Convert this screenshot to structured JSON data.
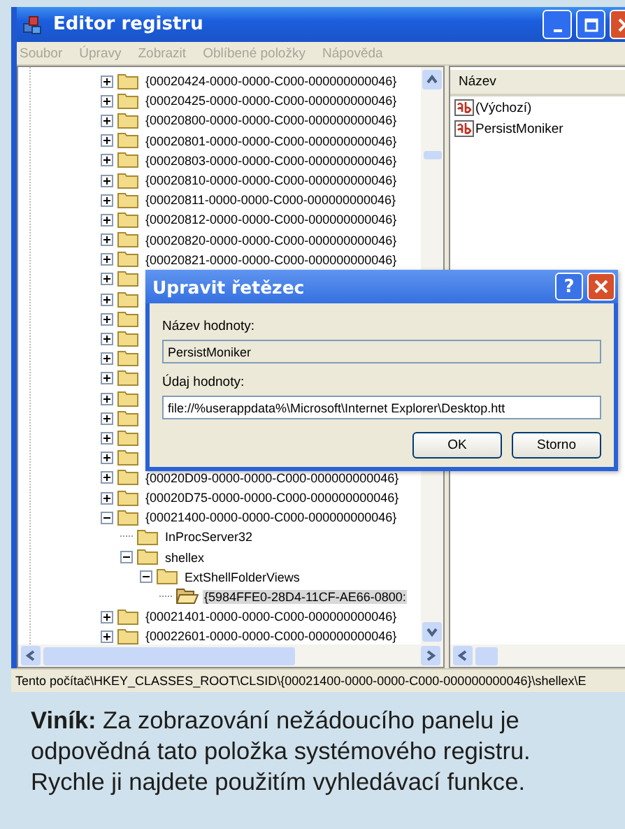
{
  "window": {
    "title": "Editor registru"
  },
  "menu": [
    {
      "label": "Soubor",
      "disabled": true
    },
    {
      "label": "Úpravy",
      "disabled": true
    },
    {
      "label": "Zobrazit",
      "disabled": true
    },
    {
      "label": "Oblíbené položky",
      "disabled": true
    },
    {
      "label": "Nápověda",
      "disabled": true
    }
  ],
  "tree": [
    {
      "label": "{00020424-0000-0000-C000-000000000046}",
      "expanded": false,
      "selected": false
    },
    {
      "label": "{00020425-0000-0000-C000-000000000046}",
      "expanded": false,
      "selected": false
    },
    {
      "label": "{00020800-0000-0000-C000-000000000046}",
      "expanded": false,
      "selected": false
    },
    {
      "label": "{00020801-0000-0000-C000-000000000046}",
      "expanded": false,
      "selected": false
    },
    {
      "label": "{00020803-0000-0000-C000-000000000046}",
      "expanded": false,
      "selected": false
    },
    {
      "label": "{00020810-0000-0000-C000-000000000046}",
      "expanded": false,
      "selected": false
    },
    {
      "label": "{00020811-0000-0000-C000-000000000046}",
      "expanded": false,
      "selected": false
    },
    {
      "label": "{00020812-0000-0000-C000-000000000046}",
      "expanded": false,
      "selected": false
    },
    {
      "label": "{00020820-0000-0000-C000-000000000046}",
      "expanded": false,
      "selected": false
    },
    {
      "label": "{00020821-0000-0000-C000-000000000046}",
      "expanded": false,
      "selected": false
    },
    {
      "expanded": false,
      "selected": false
    },
    {
      "expanded": false,
      "selected": false
    },
    {
      "expanded": false,
      "selected": false
    },
    {
      "expanded": false,
      "selected": false
    },
    {
      "expanded": false,
      "selected": false
    },
    {
      "expanded": false,
      "selected": false
    },
    {
      "expanded": false,
      "selected": false
    },
    {
      "expanded": false,
      "selected": false
    },
    {
      "expanded": false,
      "selected": false
    },
    {
      "expanded": false,
      "selected": false
    },
    {
      "label": "{00020D09-0000-0000-C000-000000000046}",
      "expanded": false,
      "selected": false
    },
    {
      "label": "{00020D75-0000-0000-C000-000000000046}",
      "expanded": false,
      "selected": false
    },
    {
      "label": "{00021400-0000-0000-C000-000000000046}",
      "expanded": true,
      "selected": false,
      "children": [
        {
          "label": "InProcServer32",
          "selected": false
        },
        {
          "label": "shellex",
          "expanded": true,
          "selected": false,
          "children": [
            {
              "label": "ExtShellFolderViews",
              "expanded": true,
              "selected": false,
              "children": [
                {
                  "label": "{5984FFE0-28D4-11CF-AE66-0800:",
                  "selected": true
                }
              ]
            }
          ]
        }
      ]
    },
    {
      "label": "{00021401-0000-0000-C000-000000000046}",
      "expanded": false,
      "selected": false
    },
    {
      "label": "{00022601-0000-0000-C000-000000000046}",
      "expanded": false,
      "selected": false
    }
  ],
  "values": {
    "columns": [
      "Název"
    ],
    "items": [
      "(Výchozí)",
      "PersistMoniker"
    ]
  },
  "status_bar": "Tento počítač\\HKEY_CLASSES_ROOT\\CLSID\\{00021400-0000-0000-C000-000000000046}\\shellex\\E",
  "dialog": {
    "title": "Upravit řetězec",
    "help_glyph": "?",
    "fields": [
      {
        "label": "Název hodnoty:",
        "value": "PersistMoniker",
        "readonly": true
      },
      {
        "label": "Údaj hodnoty:",
        "value": "file://%userappdata%\\Microsoft\\Internet Explorer\\Desktop.htt",
        "readonly": false
      }
    ],
    "buttons": [
      "OK",
      "Storno"
    ]
  },
  "caption": "**Viník:** Za zobrazování nežádoucího panelu je odpovědná tato položka systémového registru. Rychle ji najdete použitím vyhledávací funkce."
}
